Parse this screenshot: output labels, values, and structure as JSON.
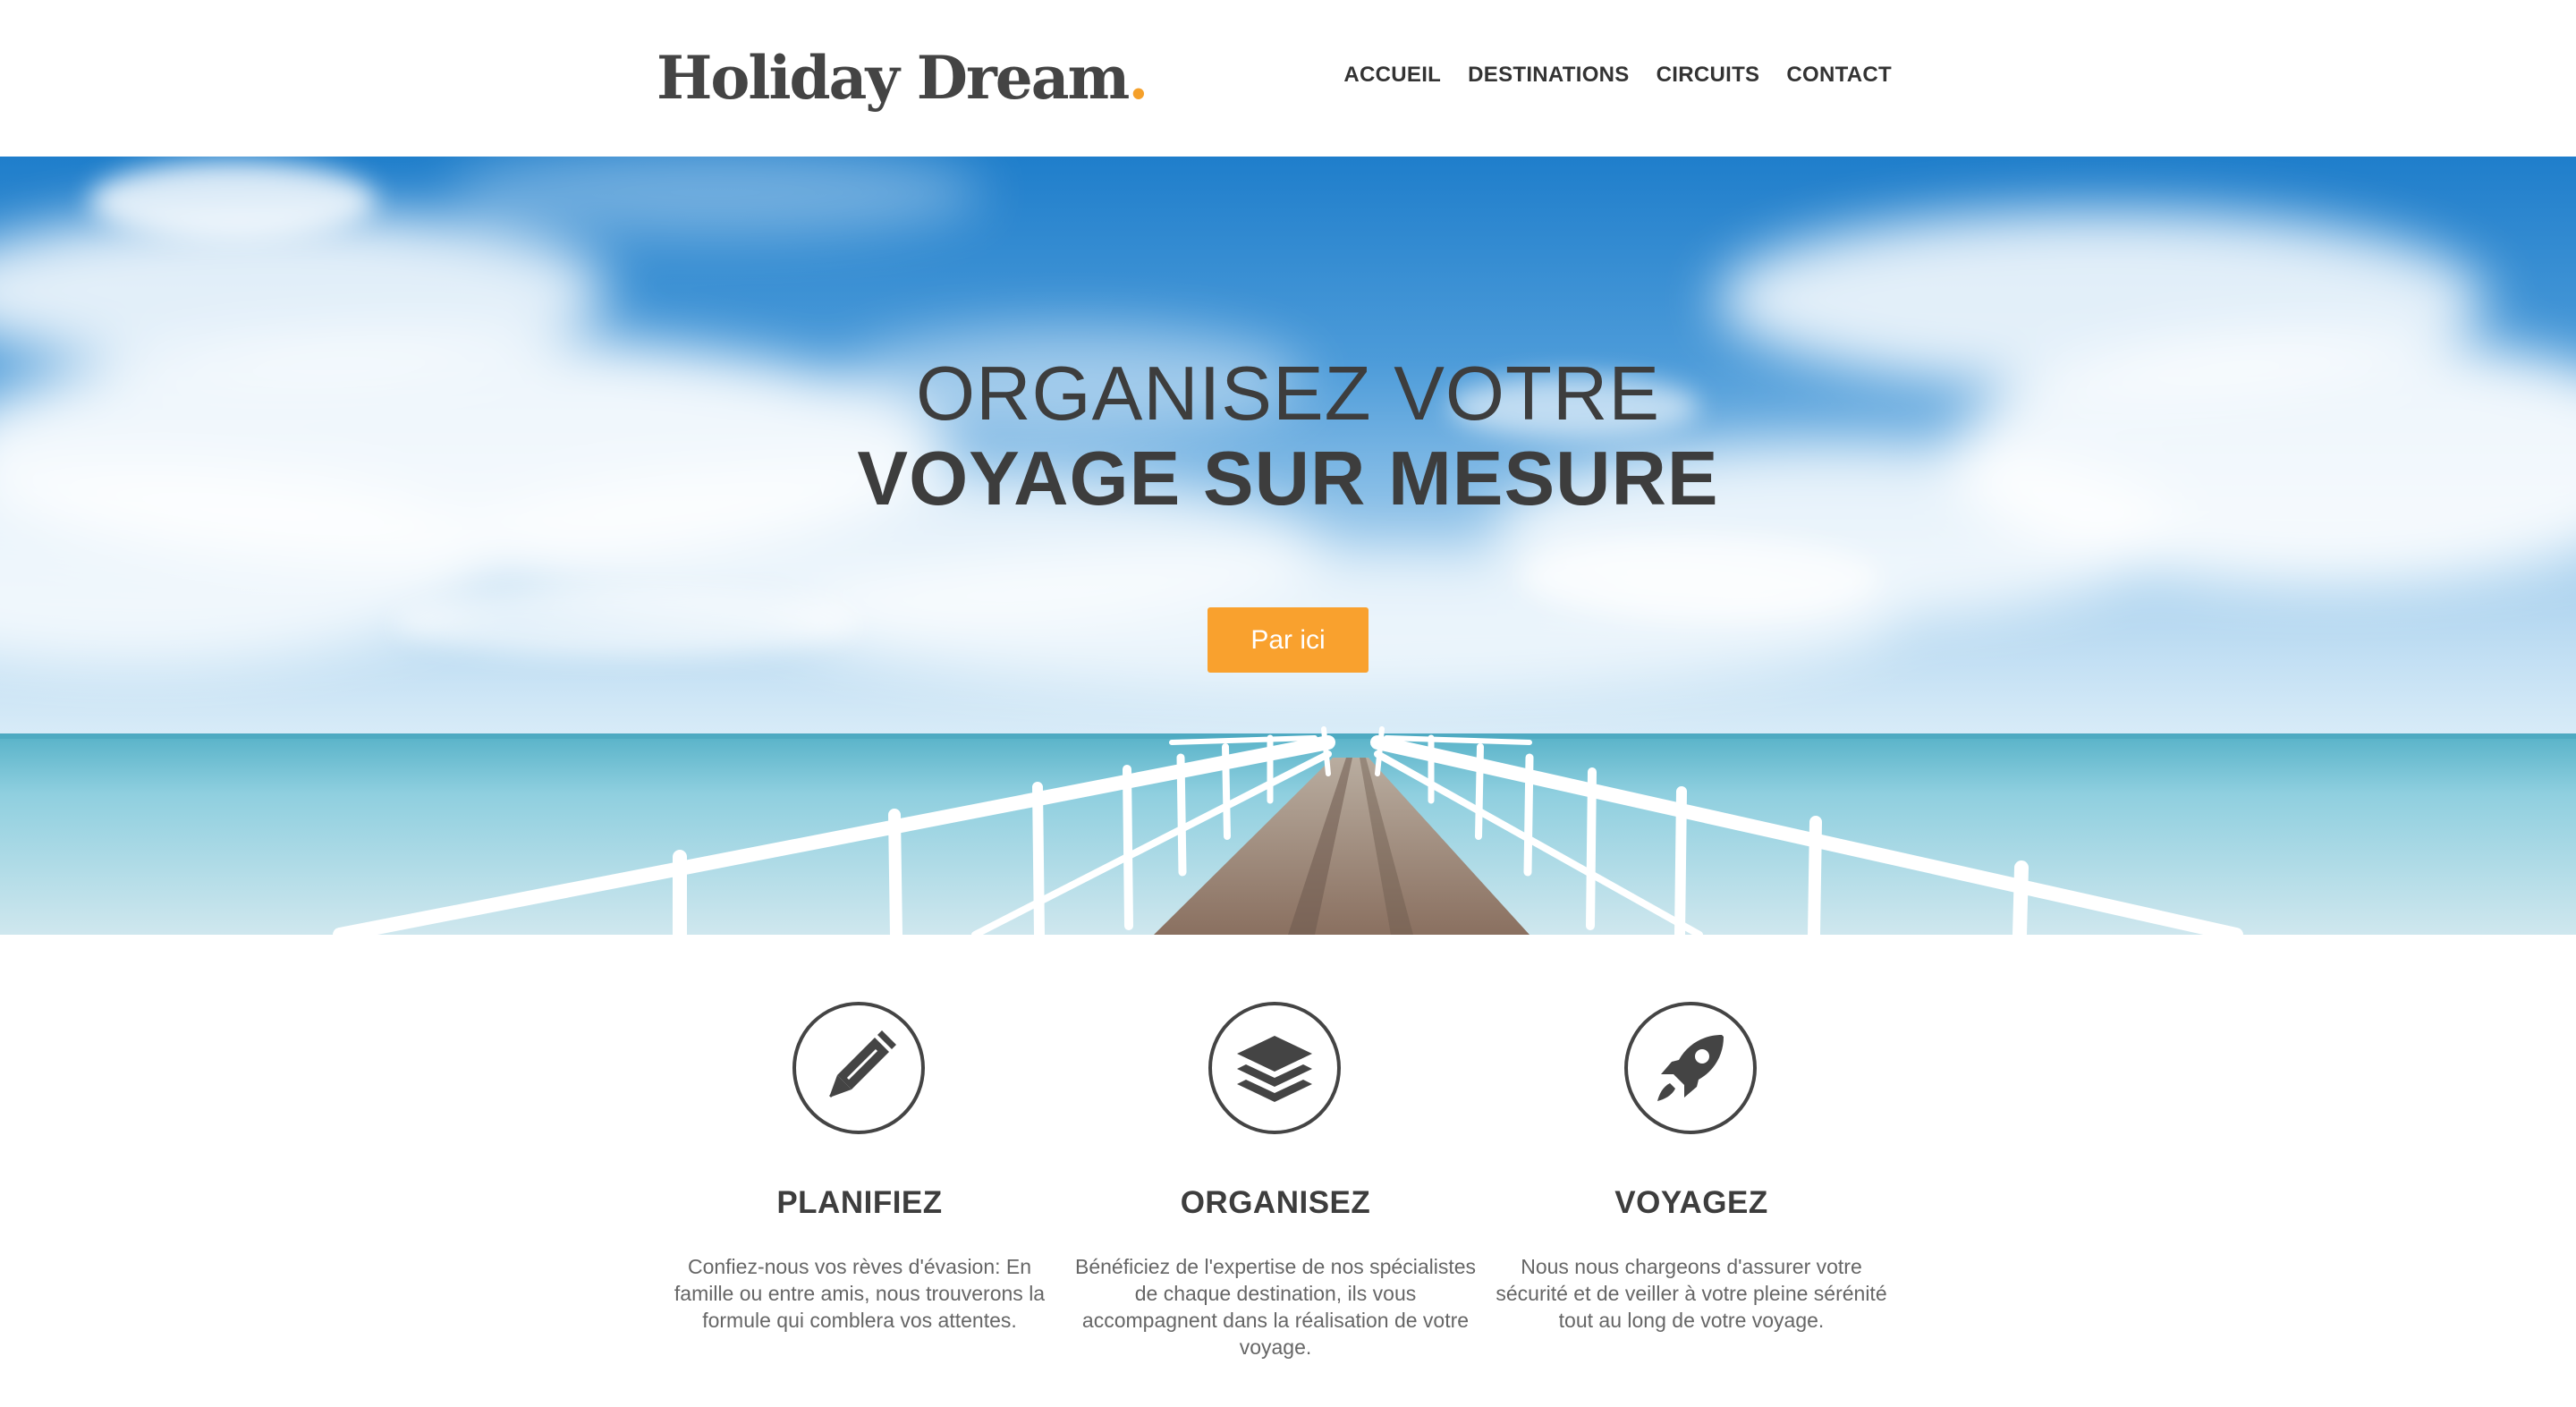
{
  "brand": {
    "name": "Holiday Dream",
    "dot": ".",
    "accent": "#f5a02a"
  },
  "nav": {
    "items": [
      "ACCUEIL",
      "DESTINATIONS",
      "CIRCUITS",
      "CONTACT"
    ]
  },
  "hero": {
    "line1": "ORGANISEZ VOTRE",
    "line2": "VOYAGE SUR MESURE",
    "button_label": "Par ici",
    "button_color": "#f9a12e",
    "image": "sky-sea-pier"
  },
  "features": [
    {
      "icon": "pen-icon",
      "title": "PLANIFIEZ",
      "text": "Confiez-nous vos rèves d'évasion: En famille ou entre amis, nous trouverons la formule qui comblera vos attentes."
    },
    {
      "icon": "layers-icon",
      "title": "ORGANISEZ",
      "text": "Bénéficiez de l'expertise de nos spécialistes de chaque destination, ils vous accompagnent dans la réalisation de votre voyage."
    },
    {
      "icon": "rocket-icon",
      "title": "VOYAGEZ",
      "text": "Nous nous chargeons d'assurer votre sécurité et de veiller à votre pleine sérénité tout au long de votre voyage."
    }
  ]
}
